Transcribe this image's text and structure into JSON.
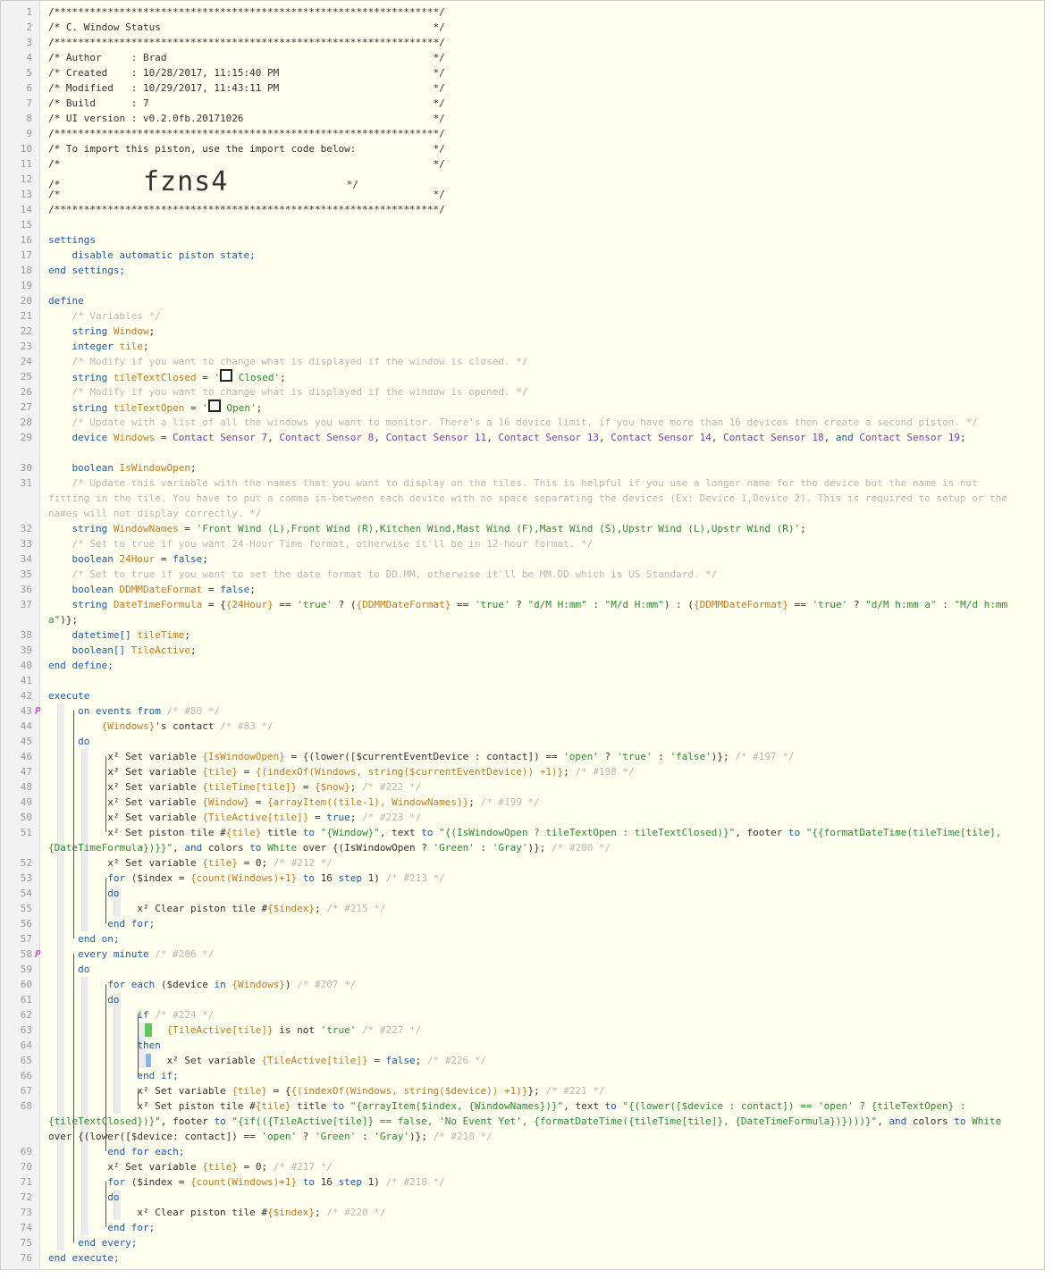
{
  "editor": {
    "lines": [
      "/*****************************************************************/",
      "/* C. Window Status                                              */",
      "/*****************************************************************/",
      "/* Author     : Brad                                             */",
      "/* Created    : 10/28/2017, 11:15:40 PM                          */",
      "/* Modified   : 10/29/2017, 11:43:11 PM                          */",
      "/* Build      : 7                                                */",
      "/* UI version : v0.2.0fb.20171026                                */",
      "/*****************************************************************/",
      "/* To import this piston, use the import code below:             */",
      "/*                                                               */",
      "/*",
      "/*                                                               */",
      "/*****************************************************************/",
      "",
      "settings",
      "    disable automatic piston state;",
      "end settings;",
      "",
      "define",
      "    /* Variables */",
      "    string Window;",
      "    integer tile;",
      "    /* Modify if you want to change what is displayed if the window is closed. */",
      "    string tileTextClosed = ' Closed';",
      "    /* Modify if you want to change what is displayed if the window is opened. */",
      "    string tileTextOpen = ' Open';",
      "    /* Update with a list of all the windows you want to monitor. There's a 16 device limit, if you have more than 16 devices then create a second piston. */",
      "    device Windows = Contact Sensor 7, Contact Sensor 8, Contact Sensor 11, Contact Sensor 13, Contact Sensor 14, Contact Sensor 18, and Contact Sensor 19;",
      "    boolean IsWindowOpen;",
      "    /* Update this variable with the names that you want to display on the tiles. This is helpful if you use a longer name for the device but the name is not fitting in the tile. You have to put a comma in-between each device with no space separating the devices (Ex: Device 1,Device 2). This is required to setup or the names will not display correctly. */",
      "    string WindowNames = 'Front Wind (L),Front Wind (R),Kitchen Wind,Mast Wind (F),Mast Wind (S),Upstr Wind (L),Upstr Wind (R)';",
      "    /* Set to true if you want 24-Hour Time format, otherwise it'll be in 12-hour format. */",
      "    boolean 24Hour = false;",
      "    /* Set to true if you want to set the date format to DD.MM, otherwise it'll be MM.DD which is US Standard. */",
      "    boolean DDMMDateFormat = false;",
      "    string DateTimeFormula = {{24Hour} == 'true' ? ({DDMMDateFormat} == 'true' ? \"d/M H:mm\" : \"M/d H:mm\") : ({DDMMDateFormat} == 'true' ? \"d/M h:mm a\" : \"M/d h:mm a\")};",
      "    datetime[] tileTime;",
      "    boolean[] TileActive;",
      "end define;",
      "",
      "execute",
      "     on events from /* #80 */",
      "         {Windows}'s contact /* #83 */",
      "     do",
      "          x² Set variable {IsWindowOpen} = {(lower([$currentEventDevice : contact]) == 'open' ? 'true' : 'false')}; /* #197 */",
      "          x² Set variable {tile} = {(indexOf(Windows, string($currentEventDevice)) +1)}; /* #198 */",
      "          x² Set variable {tileTime[tile]} = {$now}; /* #222 */",
      "          x² Set variable {Window} = {arrayItem((tile-1), WindowNames)}; /* #199 */",
      "          x² Set variable {TileActive[tile]} = true; /* #223 */",
      "          x² Set piston tile #{tile} title to \"{Window}\", text to \"{(IsWindowOpen ? tileTextOpen : tileTextClosed)}\", footer to \"{{formatDateTime(tileTime[tile], {DateTimeFormula})}}\", and colors to White over {(IsWindowOpen ? 'Green' : 'Gray')}; /* #200 */",
      "          x² Set variable {tile} = 0; /* #212 */",
      "          for ($index = {count(Windows)+1} to 16 step 1) /* #213 */",
      "          do",
      "               x² Clear piston tile #{$index}; /* #215 */",
      "          end for;",
      "     end on;",
      "     every minute /* #206 */",
      "     do",
      "          for each ($device in {Windows}) /* #207 */",
      "          do",
      "               if /* #224 */",
      "                    {TileActive[tile]} is not 'true' /* #227 */",
      "               then",
      "                    x² Set variable {TileActive[tile]} = false; /* #226 */",
      "               end if;",
      "               x² Set variable {tile} = {{(indexOf(Windows, string($device)) +1)}}; /* #221 */",
      "               x² Set piston tile #{tile} title to \"{arrayItem($index, {WindowNames})}\", text to \"{(lower([$device : contact]) == 'open' ? {tileTextOpen} : {tileTextClosed})}\", footer to \"{if(({TileActive[tile]} == false, 'No Event Yet', {formatDateTime({tileTime[tile]}, {DateTimeFormula})})))}\", and colors to White over {(lower([$device: contact]) == 'open' ? 'Green' : 'Gray')}; /* #210 */",
      "          end for each;",
      "          x² Set variable {tile} = 0; /* #217 */",
      "          for ($index = {count(Windows)+1} to 16 step 1) /* #218 */",
      "          do",
      "               x² Clear piston tile #{$index}; /* #220 */",
      "          end for;",
      "     end every;",
      "end execute;"
    ],
    "import_code": "fzns4",
    "piston_marker": "P",
    "colors": {
      "keyword": "#1f5aa0",
      "variable": "#c27a22",
      "string": "#2f8a2f",
      "comment": "#b8b8b8",
      "device": "#7a3fa8",
      "marker": "#c25ac8",
      "condition_true": "#5cc85c",
      "condition_action": "#8ab4e8"
    }
  }
}
